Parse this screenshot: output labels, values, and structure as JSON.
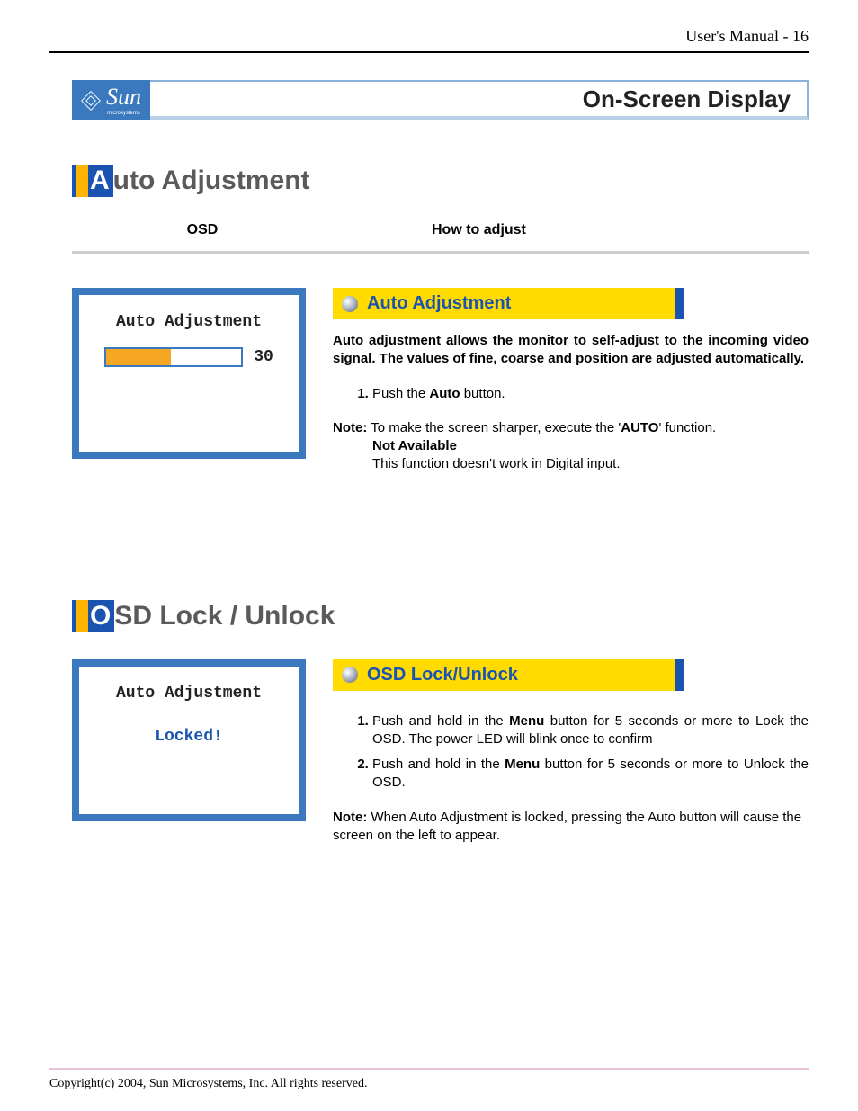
{
  "header": "User's Manual - 16",
  "brand": {
    "name": "Sun",
    "sub": "microsystems"
  },
  "pageTitle": "On-Screen Display",
  "section1": {
    "firstLetter": "A",
    "rest": "uto Adjustment",
    "colOSD": "OSD",
    "colHow": "How to adjust",
    "osdBox": {
      "title": "Auto Adjustment",
      "value": "30"
    },
    "yellowTitle": "Auto Adjustment",
    "intro": "Auto adjustment allows the monitor to self-adjust to the incoming video signal. The values of fine, coarse and position are adjusted automatically.",
    "step1_a": "Push the ",
    "step1_b": "Auto",
    "step1_c": " button.",
    "noteLabel": "Note:",
    "noteText_a": " To make the screen sharper, execute the '",
    "noteText_b": "AUTO",
    "noteText_c": "' function.",
    "noteSub1": "Not Available",
    "noteSub2": "This function doesn't work in Digital input."
  },
  "section2": {
    "firstLetter": "O",
    "rest": "SD Lock / Unlock",
    "osdBox": {
      "title": "Auto Adjustment",
      "locked": "Locked!"
    },
    "yellowTitle": "OSD Lock/Unlock",
    "step1_a": "Push and hold in the ",
    "step1_b": "Menu",
    "step1_c": "  button for 5 seconds or more to Lock the OSD. The power LED will blink once to confirm",
    "step2_a": "Push and hold in the ",
    "step2_b": "Menu",
    "step2_c": " button for 5 seconds or more to Unlock the OSD.",
    "noteLabel": "Note:",
    "noteText": " When Auto Adjustment is locked, pressing the Auto button will cause the screen on the left to appear."
  },
  "footer": "Copyright(c) 2004, Sun Microsystems, Inc. All rights reserved."
}
